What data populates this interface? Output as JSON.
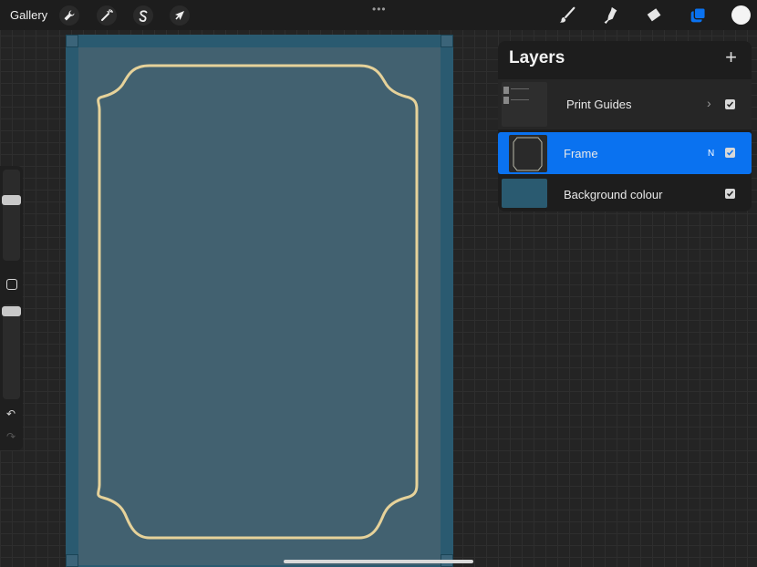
{
  "app": {
    "gallery_label": "Gallery",
    "more_indicator": "•••"
  },
  "toolbar_left": [
    {
      "name": "actions",
      "icon": "wrench-icon"
    },
    {
      "name": "adjustments",
      "icon": "magic-wand-icon"
    },
    {
      "name": "selection",
      "icon": "selection-s-icon"
    },
    {
      "name": "transform",
      "icon": "arrow-cursor-icon"
    }
  ],
  "toolbar_right": [
    {
      "name": "brush",
      "icon": "brush-icon"
    },
    {
      "name": "smudge",
      "icon": "smudge-icon"
    },
    {
      "name": "eraser",
      "icon": "eraser-icon"
    },
    {
      "name": "layers",
      "icon": "layers-icon",
      "active": true
    },
    {
      "name": "color",
      "icon": "color-swatch",
      "color": "#f4f4f4"
    }
  ],
  "layers": {
    "title": "Layers",
    "add_symbol": "+",
    "items": [
      {
        "name": "Print Guides",
        "type": "group",
        "visible": true,
        "selected": false
      },
      {
        "name": "Frame",
        "blend": "N",
        "visible": true,
        "selected": true
      },
      {
        "name": "Background colour",
        "visible": true,
        "selected": false
      }
    ]
  },
  "sidebar": {
    "undo_symbol": "↶",
    "redo_symbol": "↷"
  },
  "colors": {
    "canvas_border": "#2a5a70",
    "canvas_fill": "#426170",
    "frame_stroke": "#e6d29a",
    "accent": "#0a72f0",
    "background_swatch": "#2a5a70"
  }
}
